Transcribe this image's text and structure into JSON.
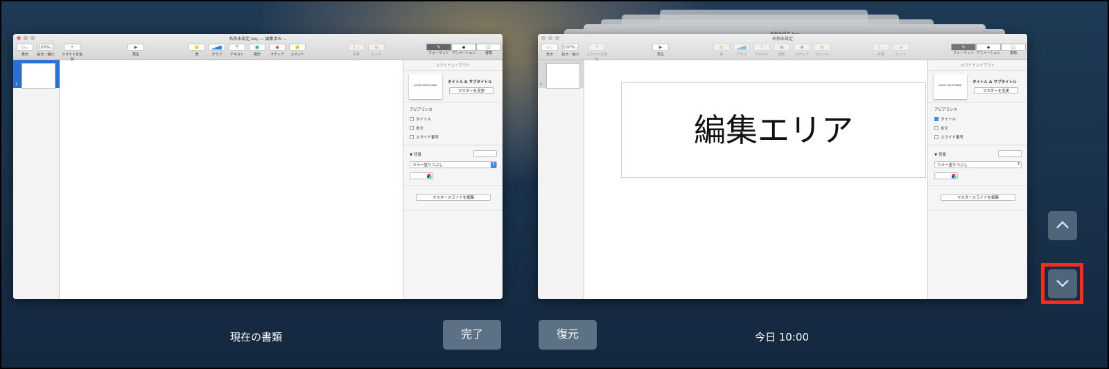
{
  "windows": [
    {
      "title": "名称未設定.key — 編集済み ⌄",
      "slide_number": "1"
    },
    {
      "title": "名称未設定",
      "behind_title": "名称未設定.key",
      "slide_number": "1",
      "canvas_text": "編集エリア"
    }
  ],
  "toolbar": {
    "view": "表示",
    "zoom_value": "100%⌄",
    "zoom": "拡大／縮小",
    "add_slide": "スライドを追加",
    "play": "再生",
    "table": "表",
    "chart": "グラフ",
    "text": "テキスト",
    "shape": "図形",
    "media": "メディア",
    "comment": "コメント",
    "share": "共有",
    "tips": "ヒント",
    "format": "フォーマット",
    "animate": "アニメーション",
    "document": "書類"
  },
  "inspector": {
    "header": "スライドレイアウト",
    "layout_preview": "Lorem Ipsum Dolor",
    "layout_name": "タイトル & サブタイトル",
    "change_master": "マスターを変更",
    "appearance": "アピアランス",
    "title_cb": "タイトル",
    "body_cb": "本文",
    "slide_number_cb": "スライド番号",
    "background": "▼ 背景",
    "fill_select": "カラー塗りつぶし",
    "edit_master": "マスタースライドを編集"
  },
  "bottom": {
    "current_label": "現在の書類",
    "done": "完了",
    "restore": "復元",
    "timestamp": "今日 10:00"
  },
  "nav": {
    "up": "⌃",
    "down": "⌄"
  },
  "colors": {
    "highlight": "#ff2a1a",
    "accent": "#3a8ef0"
  }
}
